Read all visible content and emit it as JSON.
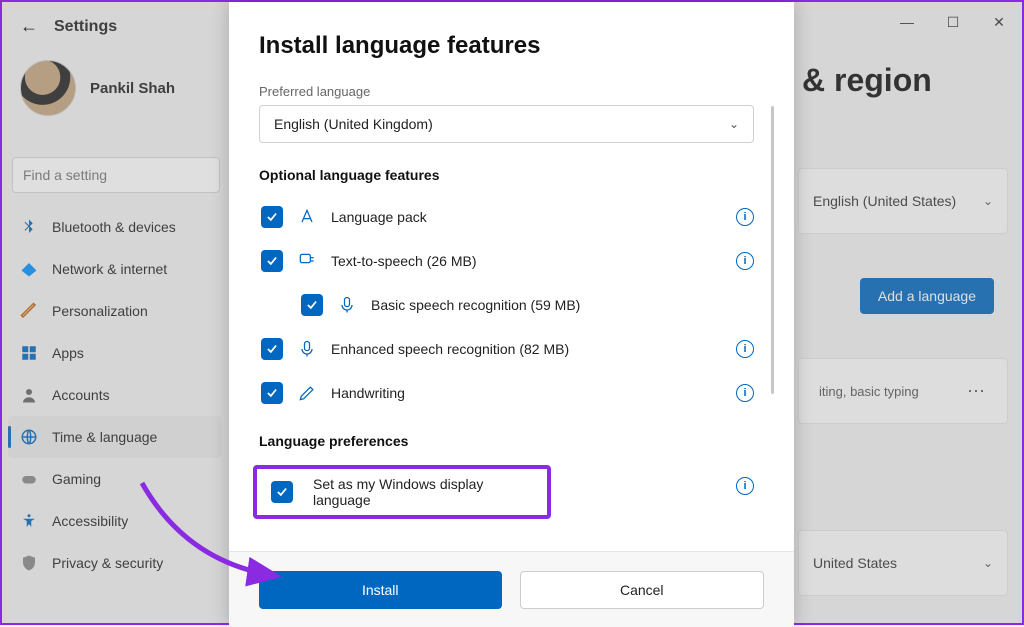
{
  "window": {
    "title": "Settings",
    "minimize": "—",
    "maximize": "☐",
    "close": "✕"
  },
  "user": {
    "name": "Pankil Shah"
  },
  "search": {
    "placeholder": "Find a setting"
  },
  "nav": {
    "items": [
      {
        "label": "Bluetooth & devices",
        "icon": "bluetooth"
      },
      {
        "label": "Network & internet",
        "icon": "wifi"
      },
      {
        "label": "Personalization",
        "icon": "brush"
      },
      {
        "label": "Apps",
        "icon": "apps"
      },
      {
        "label": "Accounts",
        "icon": "person"
      },
      {
        "label": "Time & language",
        "icon": "globe",
        "active": true
      },
      {
        "label": "Gaming",
        "icon": "gamepad"
      },
      {
        "label": "Accessibility",
        "icon": "accessibility"
      },
      {
        "label": "Privacy & security",
        "icon": "shield"
      }
    ]
  },
  "bg_page": {
    "title": "& region",
    "display_lang_value": "English (United States)",
    "add_btn": "Add a language",
    "lang_subtitle": "iting, basic typing",
    "country_value": "United States"
  },
  "dialog": {
    "title": "Install language features",
    "pref_label": "Preferred language",
    "pref_value": "English (United Kingdom)",
    "optional_header": "Optional language features",
    "features": [
      {
        "label": "Language pack"
      },
      {
        "label": "Text-to-speech (26 MB)"
      },
      {
        "label": "Basic speech recognition (59 MB)"
      },
      {
        "label": "Enhanced speech recognition (82 MB)"
      },
      {
        "label": "Handwriting"
      }
    ],
    "lang_pref_header": "Language preferences",
    "display_lang_option": "Set as my Windows display language",
    "install_btn": "Install",
    "cancel_btn": "Cancel"
  }
}
